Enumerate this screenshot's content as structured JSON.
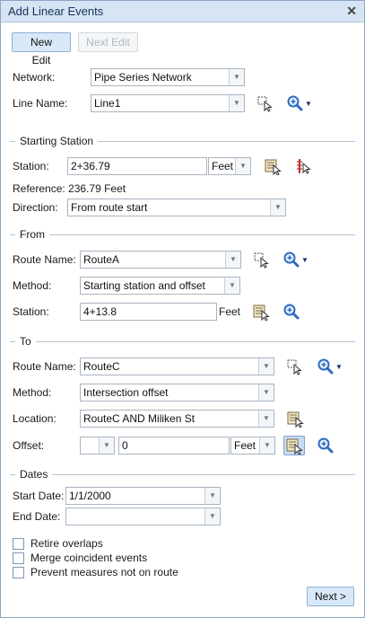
{
  "window": {
    "title": "Add Linear Events",
    "close": "✕"
  },
  "toolbar": {
    "new_edit": "New Edit",
    "next_edit": "Next Edit"
  },
  "network": {
    "label": "Network:",
    "value": "Pipe Series Network"
  },
  "line": {
    "label": "Line Name:",
    "value": "Line1"
  },
  "starting": {
    "header": "Starting Station",
    "station_label": "Station:",
    "station_value": "2+36.79",
    "station_unit": "Feet",
    "reference": "Reference: 236.79 Feet",
    "direction_label": "Direction:",
    "direction_value": "From route start"
  },
  "from": {
    "header": "From",
    "route_label": "Route Name:",
    "route_value": "RouteA",
    "method_label": "Method:",
    "method_value": "Starting station and offset",
    "station_label": "Station:",
    "station_value": "4+13.8",
    "station_unit": "Feet"
  },
  "to": {
    "header": "To",
    "route_label": "Route Name:",
    "route_value": "RouteC",
    "method_label": "Method:",
    "method_value": "Intersection offset",
    "location_label": "Location:",
    "location_value": "RouteC AND Miliken St",
    "offset_label": "Offset:",
    "offset_sign": "",
    "offset_value": "0",
    "offset_unit": "Feet"
  },
  "dates": {
    "header": "Dates",
    "start_label": "Start Date:",
    "start_value": "1/1/2000",
    "end_label": "End Date:",
    "end_value": ""
  },
  "options": {
    "retire": "Retire overlaps",
    "merge": "Merge coincident events",
    "prevent": "Prevent measures not on route"
  },
  "footer": {
    "next": "Next >"
  },
  "icons": {
    "select_on_map": "cursor-select-icon",
    "zoom": "zoom-in-icon",
    "dropdown": "chevron-down-icon",
    "measure_tool": "measure-table-icon",
    "pick_station": "pick-station-icon"
  },
  "colors": {
    "titlebar": "#d7e4f3",
    "accent": "#2c6cc0",
    "border": "#8aa6c4"
  }
}
